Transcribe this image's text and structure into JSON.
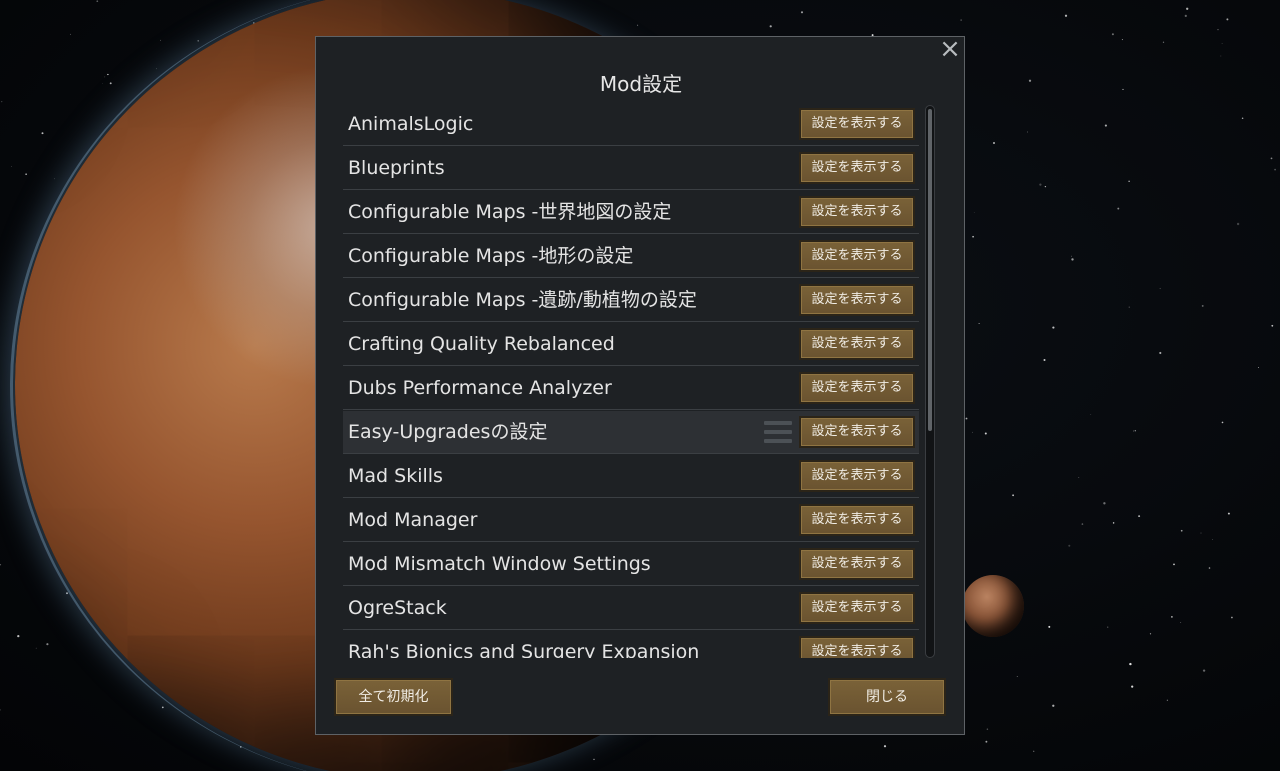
{
  "dialog": {
    "title": "Mod設定",
    "close_icon": "×",
    "view_settings_label": "設定を表示する",
    "mods": [
      "AnimalsLogic",
      "Blueprints",
      "Configurable Maps -世界地図の設定",
      "Configurable Maps -地形の設定",
      "Configurable Maps -遺跡/動植物の設定",
      "Crafting Quality Rebalanced",
      "Dubs Performance Analyzer",
      "Easy-Upgradesの設定",
      "Mad Skills",
      "Mod Manager",
      "Mod Mismatch Window Settings",
      "OgreStack",
      "Rah's Bionics and Surgery Expansion"
    ],
    "hovered_mod": "Easy-Upgradesの設定",
    "reset_all_label": "全て初期化",
    "close_label": "閉じる"
  },
  "colors": {
    "button_fill": "#735b34",
    "dialog_bg": "#1e2124",
    "text": "#e4e4e4"
  },
  "icons": {
    "close": "close-icon",
    "row_handle": "list-icon"
  }
}
